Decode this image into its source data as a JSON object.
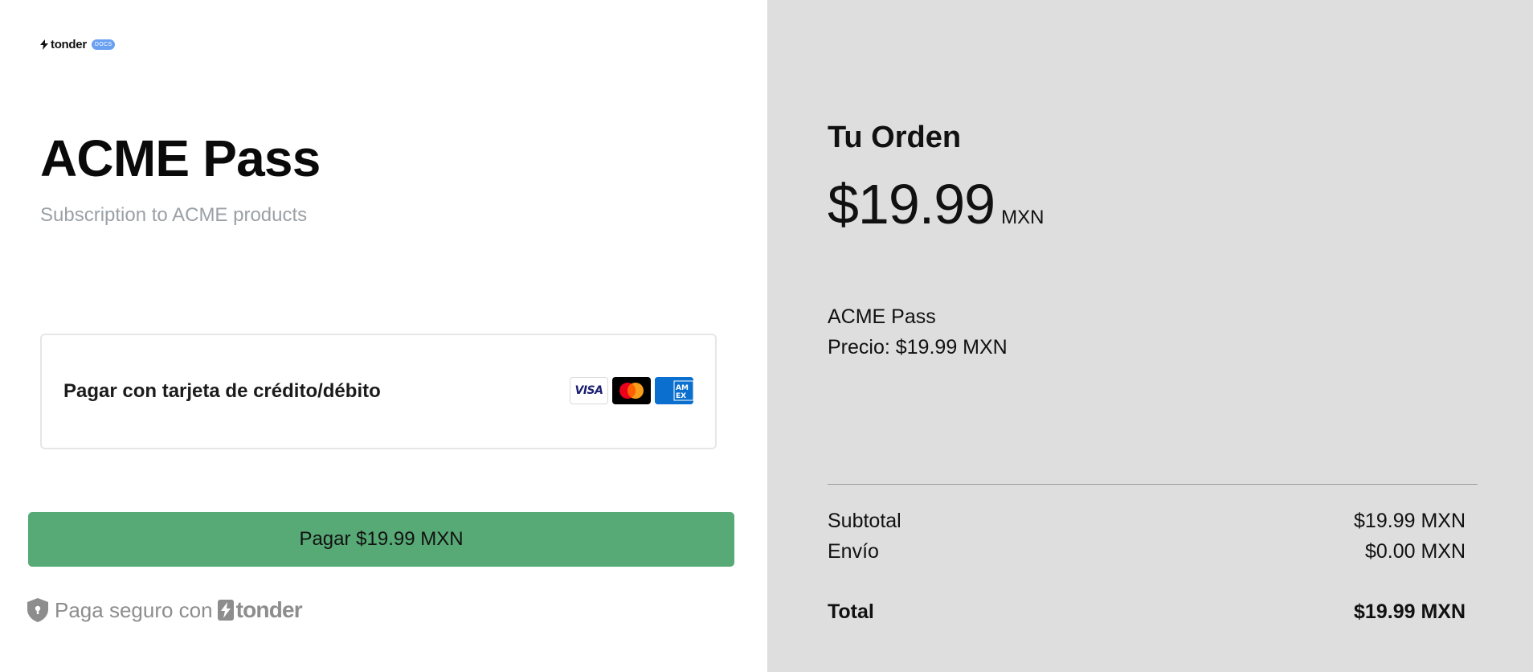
{
  "logo": {
    "brand": "tonder",
    "badge": "DOCS"
  },
  "product": {
    "title": "ACME Pass",
    "subtitle": "Subscription to ACME products"
  },
  "payment_method": {
    "label": "Pagar con tarjeta de crédito/débito",
    "cards": [
      "visa-icon",
      "mastercard-icon",
      "amex-icon"
    ],
    "visa_text": "VISA"
  },
  "pay_button": {
    "label": "Pagar $19.99 MXN",
    "color": "#57aa76"
  },
  "secure": {
    "text": "Paga seguro con",
    "brand": "tonder"
  },
  "order": {
    "title": "Tu Orden",
    "amount": "$19.99",
    "currency": "MXN",
    "item_name": "ACME Pass",
    "item_price": "Precio: $19.99 MXN",
    "subtotal_label": "Subtotal",
    "subtotal_value": "$19.99 MXN",
    "shipping_label": "Envío",
    "shipping_value": "$0.00 MXN",
    "total_label": "Total",
    "total_value": "$19.99 MXN"
  },
  "colors": {
    "summary_bg": "#dedede",
    "badge": "#6aa0f2"
  }
}
